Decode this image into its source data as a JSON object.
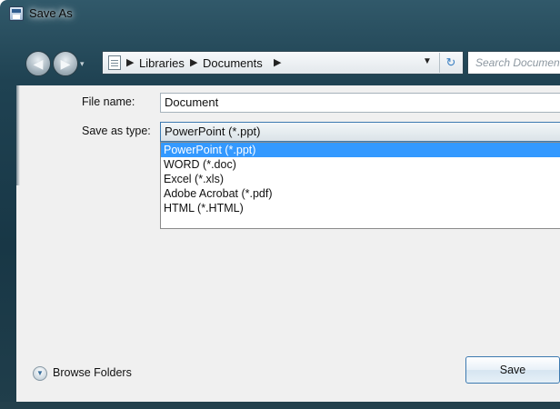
{
  "window": {
    "title": "Save As"
  },
  "navigation": {
    "back_icon": "back-arrow-icon",
    "forward_icon": "forward-arrow-icon",
    "breadcrumbs": [
      "Libraries",
      "Documents"
    ],
    "search_placeholder": "Search Documents"
  },
  "form": {
    "file_name_label": "File name:",
    "file_name_value": "Document",
    "save_type_label": "Save as type:",
    "save_type_value": "PowerPoint (*.ppt)",
    "type_options": [
      "PowerPoint (*.ppt)",
      "WORD (*.doc)",
      "Excel (*.xls)",
      "Adobe Acrobat (*.pdf)",
      "HTML (*.HTML)"
    ],
    "selected_option_index": 0
  },
  "footer": {
    "browse_label": "Browse Folders",
    "save_label": "Save"
  },
  "colors": {
    "selection": "#3399ff",
    "frame": "#1f4252"
  }
}
